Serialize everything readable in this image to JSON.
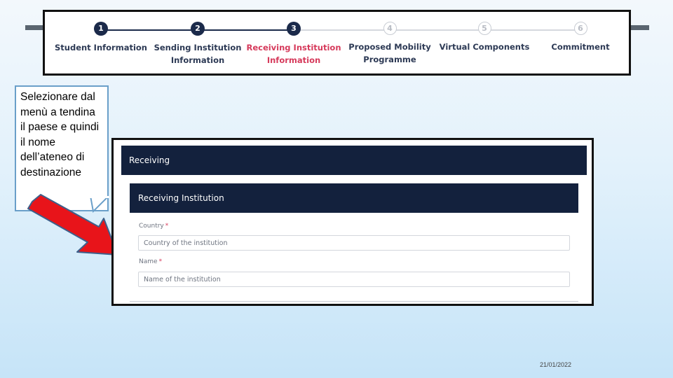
{
  "stepper": {
    "steps": [
      {
        "number": "1",
        "label": "Student Information",
        "state": "done"
      },
      {
        "number": "2",
        "label": "Sending Institution Information",
        "state": "done"
      },
      {
        "number": "3",
        "label": "Receiving Institution Information",
        "state": "active"
      },
      {
        "number": "4",
        "label": "Proposed Mobility Programme",
        "state": "todo"
      },
      {
        "number": "5",
        "label": "Virtual Components",
        "state": "todo"
      },
      {
        "number": "6",
        "label": "Commitment",
        "state": "todo"
      }
    ]
  },
  "callout": {
    "text": "Selezionare dal menù a tendina il paese e quindi il nome dell’ateneo di destinazione"
  },
  "form": {
    "header": "Receiving",
    "section_title": "Receiving Institution",
    "country": {
      "label": "Country",
      "required_mark": "*",
      "placeholder": "Country of the institution"
    },
    "name": {
      "label": "Name",
      "required_mark": "*",
      "placeholder": "Name of the institution"
    }
  },
  "footer": {
    "date": "21/01/2022"
  },
  "colors": {
    "navy": "#13213d",
    "active_step": "#d63a5b",
    "arrow": "#e8141a",
    "callout_border": "#6a9fc9"
  }
}
